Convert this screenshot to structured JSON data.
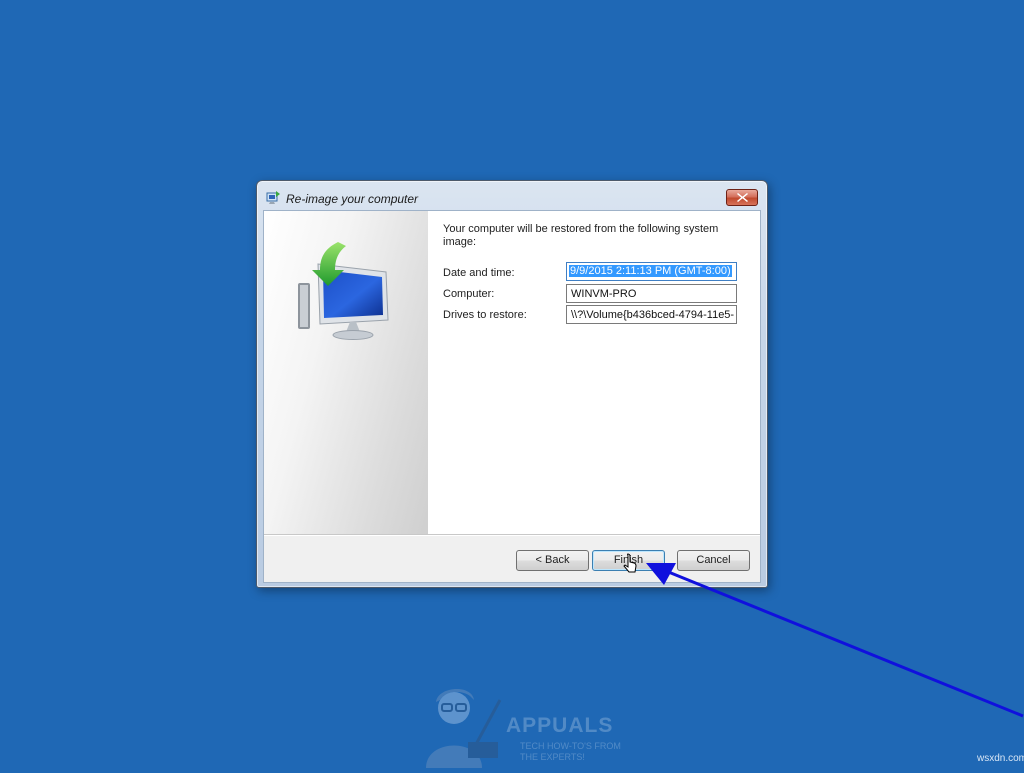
{
  "window": {
    "title": "Re-image your computer"
  },
  "content": {
    "intro": "Your computer will be restored from the following system image:",
    "fields": [
      {
        "label": "Date and time:",
        "value": "9/9/2015 2:11:13 PM (GMT-8:00)"
      },
      {
        "label": "Computer:",
        "value": "WINVM-PRO"
      },
      {
        "label": "Drives to restore:",
        "value": "\\\\?\\Volume{b436bced-4794-11e5-"
      }
    ]
  },
  "buttons": {
    "back": "< Back",
    "finish": "Finish",
    "cancel": "Cancel"
  },
  "watermark": {
    "brand": "APPUALS",
    "tagline_1": "TECH HOW-TO'S FROM",
    "tagline_2": "THE EXPERTS!"
  },
  "site_credit": "wsxdn.com",
  "colors": {
    "desktop": "#1f68b5",
    "annotation_arrow": "#1010dd",
    "selection": "#3399ff"
  }
}
